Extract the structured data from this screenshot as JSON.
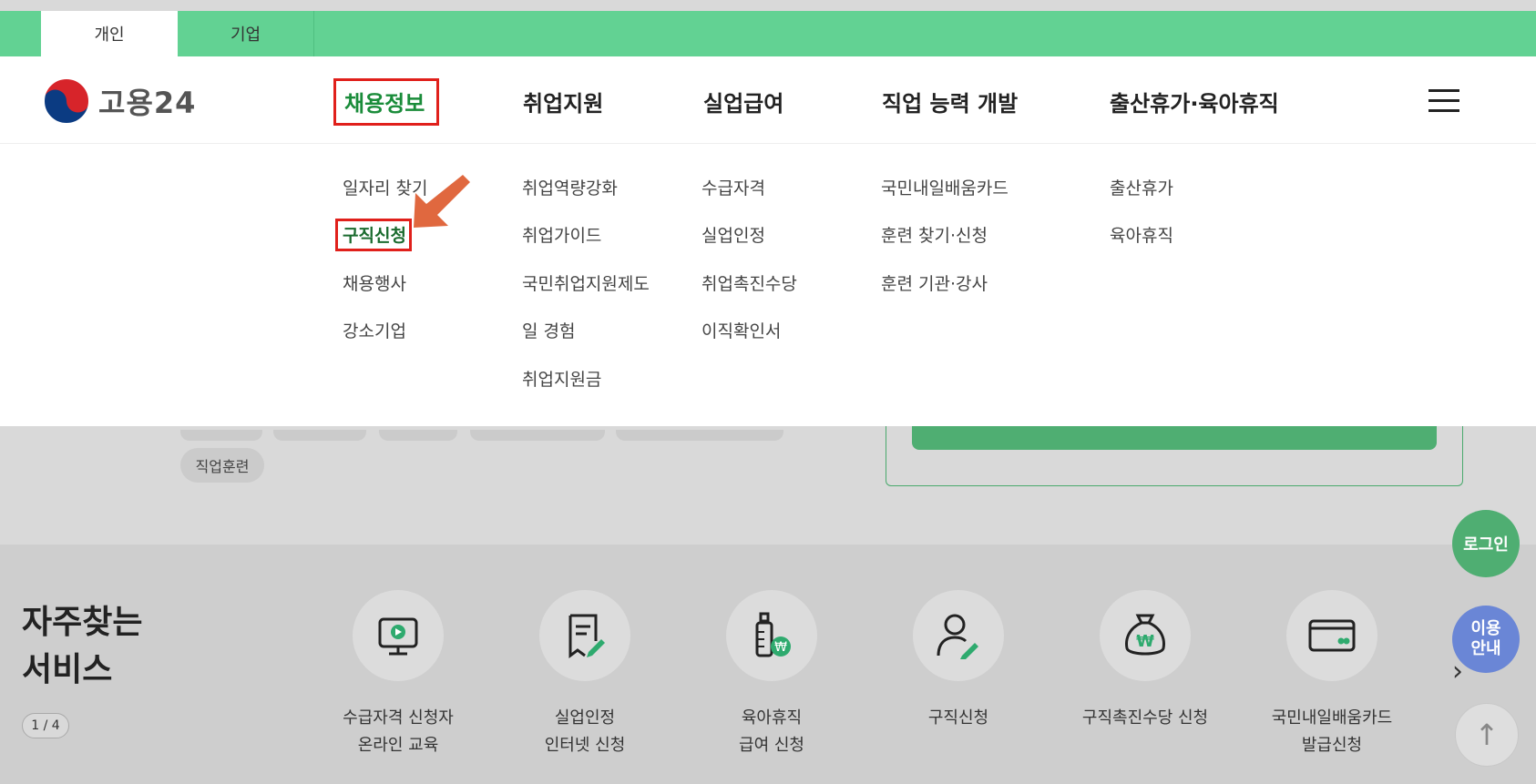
{
  "tabs": [
    {
      "label": "개인"
    },
    {
      "label": "기업"
    }
  ],
  "logo": {
    "text": "고용24"
  },
  "nav": [
    {
      "label": "채용정보"
    },
    {
      "label": "취업지원"
    },
    {
      "label": "실업급여"
    },
    {
      "label": "직업 능력 개발"
    },
    {
      "label": "출산휴가·육아휴직"
    }
  ],
  "dropdown": {
    "col1": [
      "일자리 찾기",
      "구직신청",
      "채용행사",
      "강소기업"
    ],
    "col2": [
      "취업역량강화",
      "취업가이드",
      "국민취업지원제도",
      "일 경험",
      "취업지원금"
    ],
    "col3": [
      "수급자격",
      "실업인정",
      "취업촉진수당",
      "이직확인서"
    ],
    "col4": [
      "국민내일배움카드",
      "훈련 찾기·신청",
      "훈련 기관·강사"
    ],
    "col5": [
      "출산휴가",
      "육아휴직"
    ]
  },
  "chips": {
    "visible": "직업훈련"
  },
  "fav": {
    "title": "자주찾는\n서비스",
    "pager": "1 / 4",
    "services": [
      {
        "label": "수급자격 신청자\n온라인 교육",
        "icon": "monitor-play-icon"
      },
      {
        "label": "실업인정\n인터넷 신청",
        "icon": "document-edit-icon"
      },
      {
        "label": "육아휴직\n급여 신청",
        "icon": "baby-bottle-won-icon"
      },
      {
        "label": "구직신청",
        "icon": "person-edit-icon"
      },
      {
        "label": "구직촉진수당 신청",
        "icon": "money-bag-won-icon"
      },
      {
        "label": "국민내일배움카드\n발급신청",
        "icon": "card-icon"
      }
    ]
  },
  "floating": {
    "login": "로그인",
    "guide": "이용\n안내",
    "top": "↑"
  },
  "colors": {
    "brand_green": "#62d293",
    "active_green": "#1a8c3a",
    "highlight_red": "#e0201b",
    "guide_blue": "#6a86d6"
  }
}
